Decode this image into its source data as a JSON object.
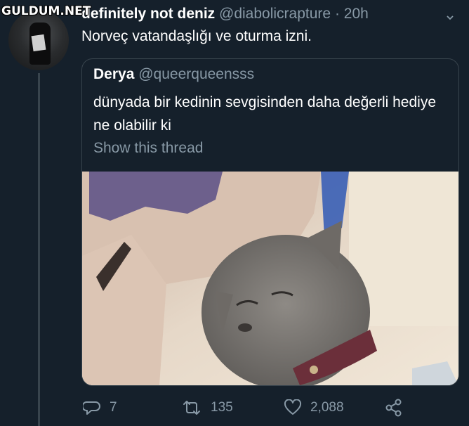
{
  "watermark": "GULDUM.NET",
  "tweet": {
    "display_name": "definitely not deniz",
    "handle": "@diabolicrapture",
    "separator": "·",
    "time": "20h",
    "text": "Norveç vatandaşlığı ve oturma izni."
  },
  "quoted_tweet": {
    "display_name": "Derya",
    "handle": "@queerqueensss",
    "text": "dünyada bir kedinin sevgisinden daha değerli hediye ne olabilir ki",
    "show_thread": "Show this thread"
  },
  "actions": {
    "reply_count": "7",
    "retweet_count": "135",
    "like_count": "2,088"
  },
  "icons": {
    "menu": "chevron-down-icon",
    "reply": "reply-icon",
    "retweet": "retweet-icon",
    "like": "heart-icon",
    "share": "share-icon"
  },
  "colors": {
    "background": "#15202b",
    "secondary_text": "#8899a6",
    "border": "#38444d"
  }
}
